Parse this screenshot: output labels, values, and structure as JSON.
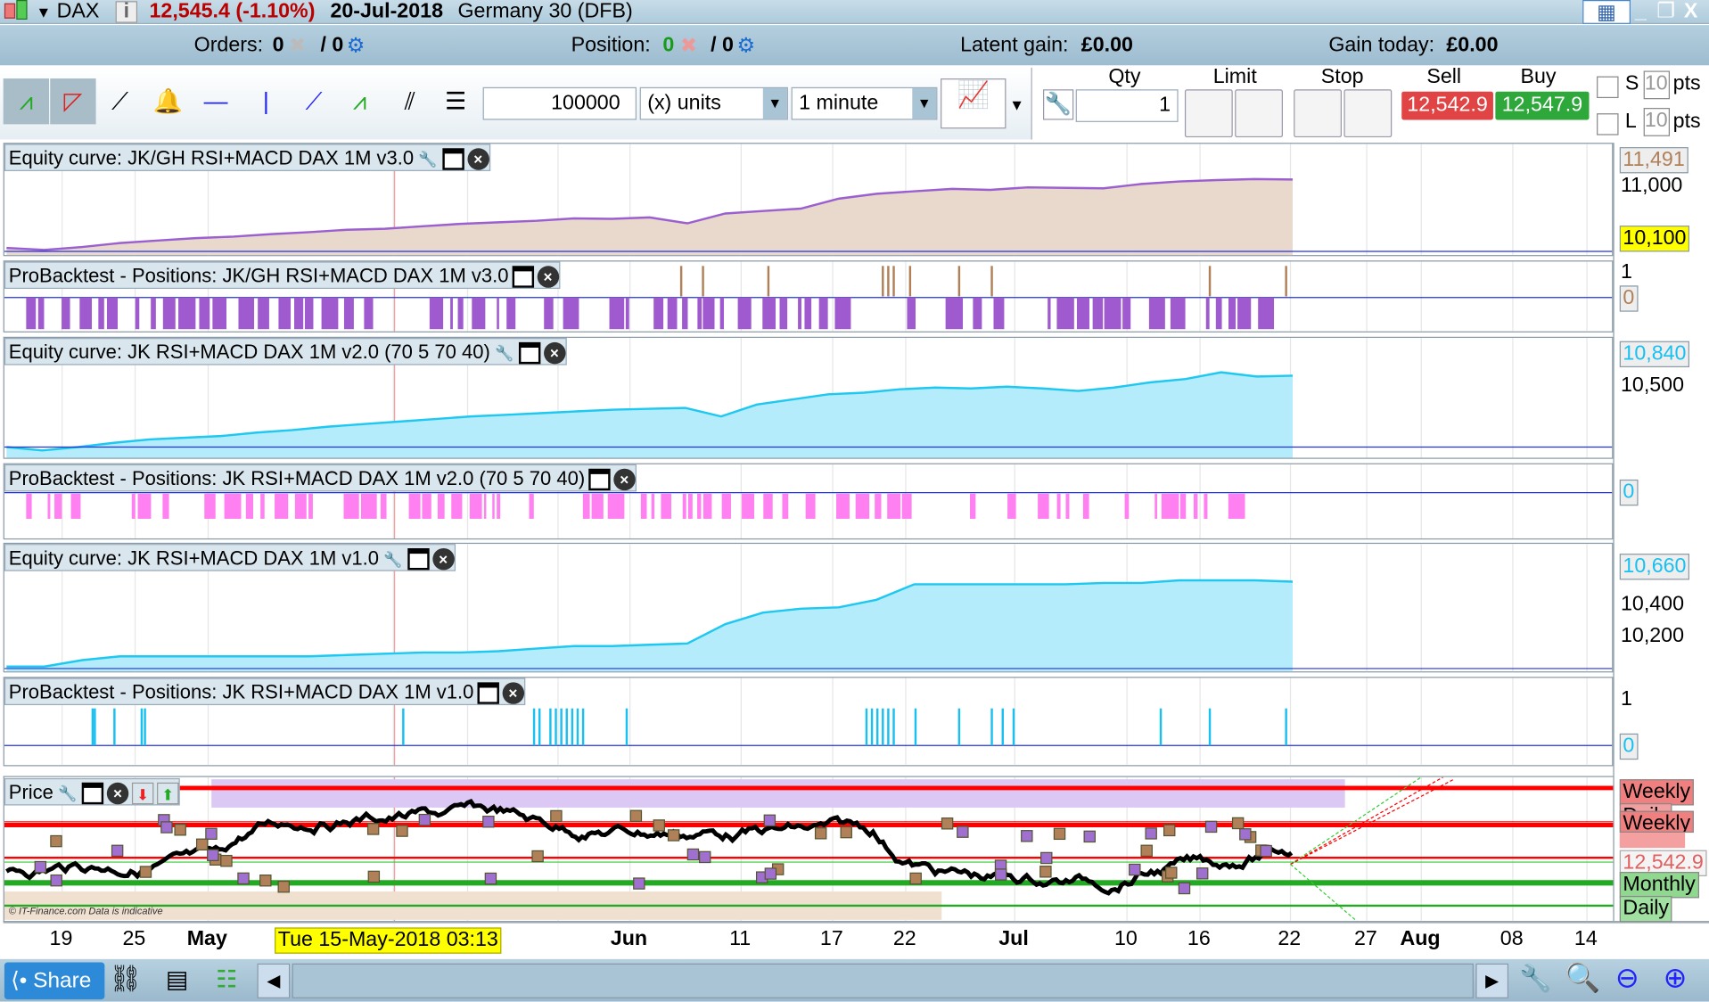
{
  "titlebar": {
    "symbol": "DAX",
    "price_change": "12,545.4 (-1.10%)",
    "date": "20-Jul-2018",
    "instrument": "Germany 30 (DFB)"
  },
  "status": {
    "orders_label": "Orders:",
    "orders_value": "0",
    "orders_total": "/ 0",
    "position_label": "Position:",
    "position_value": "0",
    "position_total": "/ 0",
    "latent_label": "Latent gain:",
    "latent_value": "£0.00",
    "gain_today_label": "Gain today:",
    "gain_today_value": "£0.00"
  },
  "toolbar": {
    "quantity": "100000",
    "units": "(x) units",
    "timeframe": "1 minute"
  },
  "orderbar": {
    "qty_label": "Qty",
    "qty_value": "1",
    "limit_label": "Limit",
    "stop_label": "Stop",
    "sell_label": "Sell",
    "buy_label": "Buy",
    "sell_price": "12,542.9",
    "buy_price": "12,547.9",
    "s_label": "S",
    "l_label": "L",
    "s_pts": "10",
    "l_pts": "10",
    "pts_label": "pts",
    "sell_color": "#e04444",
    "buy_color": "#2ea83a"
  },
  "panels": {
    "eq3": {
      "title": "Equity curve: JK/GH RSI+MACD DAX 1M v3.0",
      "ticks": [
        "11,000"
      ],
      "current": "11,491",
      "start": "10,100",
      "values": [
        10100,
        10060,
        10120,
        10200,
        10250,
        10300,
        10330,
        10380,
        10420,
        10470,
        10490,
        10540,
        10590,
        10620,
        10650,
        10700,
        10690,
        10720,
        10600,
        10800,
        10850,
        10900,
        11100,
        11200,
        11250,
        11300,
        11280,
        11330,
        11320,
        11310,
        11400,
        11450,
        11480,
        11500,
        11491
      ]
    },
    "pos3": {
      "title": "ProBacktest - Positions: JK/GH RSI+MACD DAX 1M v3.0",
      "ticks": [
        "1"
      ],
      "current": "0"
    },
    "eq2": {
      "title": "Equity curve: JK RSI+MACD DAX 1M v2.0 (70 5 70 40)",
      "ticks": [
        "10,500"
      ],
      "current": "10,840",
      "values": [
        10000,
        9960,
        10000,
        10050,
        10090,
        10110,
        10130,
        10170,
        10200,
        10240,
        10270,
        10300,
        10330,
        10360,
        10380,
        10400,
        10420,
        10440,
        10450,
        10460,
        10360,
        10500,
        10560,
        10620,
        10640,
        10680,
        10700,
        10690,
        10710,
        10690,
        10660,
        10700,
        10760,
        10800,
        10880,
        10830,
        10840
      ]
    },
    "pos2": {
      "title": "ProBacktest - Positions: JK RSI+MACD DAX 1M v2.0 (70 5 70 40)",
      "current": "0"
    },
    "eq1": {
      "title": "Equity curve: JK RSI+MACD DAX 1M v1.0",
      "ticks": [
        "10,400",
        "10,200"
      ],
      "current": "10,660",
      "values": [
        10000,
        10000,
        10050,
        10080,
        10080,
        10080,
        10080,
        10080,
        10080,
        10090,
        10100,
        10110,
        10110,
        10120,
        10140,
        10160,
        10160,
        10170,
        10180,
        10330,
        10420,
        10450,
        10460,
        10520,
        10640,
        10640,
        10640,
        10640,
        10640,
        10650,
        10650,
        10670,
        10670,
        10670,
        10660
      ]
    },
    "pos1": {
      "title": "ProBacktest - Positions: JK RSI+MACD DAX 1M v1.0",
      "ticks": [
        "1"
      ],
      "current": "0"
    },
    "price": {
      "title": "Price",
      "current": "12,542.9",
      "levels": [
        "Weekly",
        "Daily",
        "Weekly",
        "Monthly",
        "Daily"
      ]
    }
  },
  "xaxis": {
    "labels": [
      "19",
      "25",
      "May",
      "Jun",
      "11",
      "17",
      "22",
      "Jul",
      "10",
      "16",
      "22",
      "27",
      "Aug",
      "08",
      "14"
    ],
    "tooltip": "Tue 15-May-2018 03:13"
  },
  "copyright": "© IT-Finance.com Data is indicative",
  "bottombar": {
    "share_label": "Share"
  },
  "colors": {
    "eq3_line": "#9b5fd0",
    "eq3_fill": "#e8d9cc",
    "eq_blue": "#1ec8f0",
    "eq_blue_fill": "#b4ecfb",
    "pos3_bar": "#a05ad0",
    "pos3_up": "#b08058",
    "pos2_bar": "#ff80f0",
    "pos_blue": "#19c0f0"
  }
}
